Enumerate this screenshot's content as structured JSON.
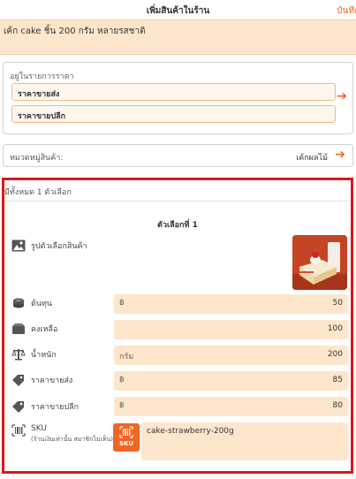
{
  "header": {
    "title": "เพิ่มสินค้าในร้าน",
    "save_label": "บันทึก"
  },
  "product": {
    "name": "เค้ก cake ชิ้น 200 กรัม หลายรสชาติ"
  },
  "price_list": {
    "label": "อยู่ในรายการราคา",
    "items": [
      "ราคาขายส่ง",
      "ราคาขายปลีก"
    ]
  },
  "category": {
    "label": "หมวดหมู่สินค้า:",
    "value": "เค้กผลไม้"
  },
  "options": {
    "count_text": "มีทั้งหมด 1 ตัวเลือก",
    "heading": "ตัวเลือกที่ 1",
    "image_label": "รูปตัวเลือกสินค้า",
    "fields": [
      {
        "label": "ต้นทุน",
        "prefix": "฿",
        "value": "50",
        "icon": "coins-icon"
      },
      {
        "label": "คงเหลือ",
        "prefix": "",
        "value": "100",
        "icon": "box-icon"
      },
      {
        "label": "น้ำหนัก",
        "prefix": "กรัม",
        "value": "200",
        "icon": "scale-icon"
      },
      {
        "label": "ราคาขายส่ง",
        "prefix": "฿",
        "value": "85",
        "icon": "tag-icon"
      },
      {
        "label": "ราคาขายปลีก",
        "prefix": "฿",
        "value": "80",
        "icon": "tag-icon"
      }
    ],
    "sku": {
      "label": "SKU",
      "sublabel": "(ร้านเงินเท่านั้น สมาชิกไม่เห็น)",
      "badge": "SKU",
      "value": "cake-strawberry-200g"
    }
  },
  "colors": {
    "accent": "#f26522",
    "field_bg": "#fde6cc",
    "highlight_border": "#e2141b"
  }
}
